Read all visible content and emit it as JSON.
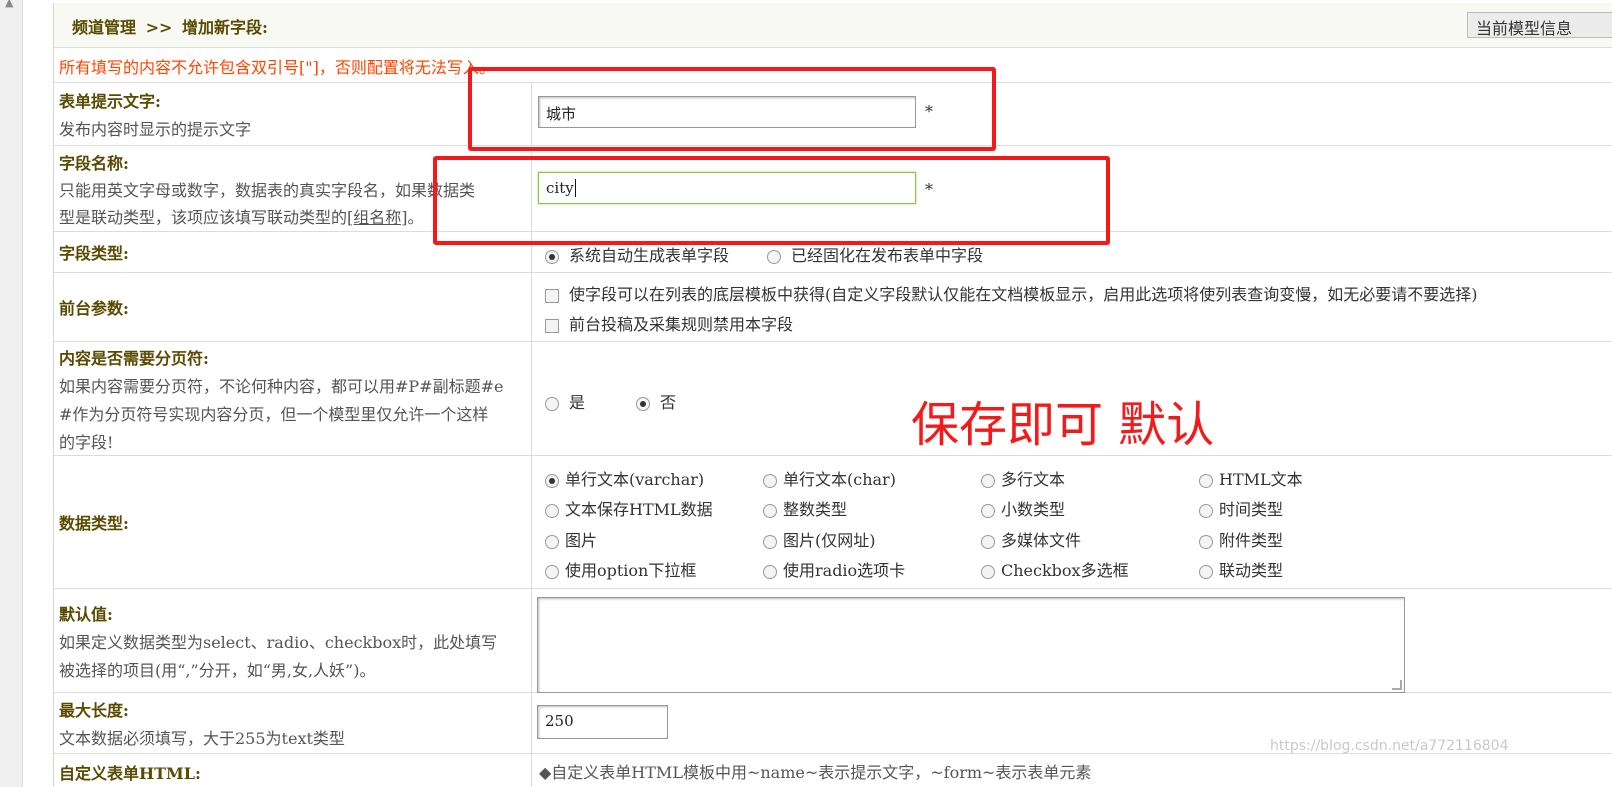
{
  "header": {
    "crumb_1": "频道管理",
    "crumb_sep": ">>",
    "crumb_2": "增加新字段:",
    "model_button": "当前模型信息"
  },
  "warning": "所有填写的内容不允许包含双引号[\"]，否则配置将无法写入。",
  "form_label": {
    "title": "表单提示文字:",
    "desc": "发布内容时显示的提示文字",
    "value": "城市",
    "required": "*"
  },
  "field_name": {
    "title": "字段名称:",
    "desc_1": "只能用英文字母或数字，数据表的真实字段名，如果数据类",
    "desc_2": "型是联动类型，该项应该填写联动类型的",
    "desc_link": "[组名称]",
    "desc_end": "。",
    "value": "city",
    "required": "*"
  },
  "field_type": {
    "title": "字段类型:",
    "options": [
      "系统自动生成表单字段",
      "已经固化在发布表单中字段"
    ],
    "selected": 0
  },
  "frontend": {
    "title": "前台参数:",
    "options": [
      "使字段可以在列表的底层模板中获得(自定义字段默认仅能在文档模板显示，启用此选项将使列表查询变慢，如无必要请不要选择)",
      "前台投稿及采集规则禁用本字段"
    ]
  },
  "pagebreak": {
    "title": "内容是否需要分页符:",
    "desc_1": "如果内容需要分页符，不论何种内容，都可以用#P#副标题#e",
    "desc_2": "#作为分页符号实现内容分页，但一个模型里仅允许一个这样",
    "desc_3": "的字段!",
    "options": [
      "是",
      "否"
    ],
    "selected": 1
  },
  "datatype": {
    "title": "数据类型:",
    "options": [
      "单行文本(varchar)",
      "单行文本(char)",
      "多行文本",
      "HTML文本",
      "文本保存HTML数据",
      "整数类型",
      "小数类型",
      "时间类型",
      "图片",
      "图片(仅网址)",
      "多媒体文件",
      "附件类型",
      "使用option下拉框",
      "使用radio选项卡",
      "Checkbox多选框",
      "联动类型"
    ],
    "selected": 0
  },
  "default_value": {
    "title": "默认值:",
    "desc_1": "如果定义数据类型为select、radio、checkbox时，此处填写",
    "desc_2": "被选择的项目(用“,”分开，如“男,女,人妖”)。"
  },
  "max_length": {
    "title": "最大长度:",
    "desc": "文本数据必须填写，大于255为text类型",
    "value": "250"
  },
  "custom_html": {
    "title": "自定义表单HTML:",
    "desc": "◆自定义表单HTML模板中用~name~表示提示文字，~form~表示表单元素"
  },
  "annotation": {
    "note": "保存即可 默认",
    "color": "#f21a1a"
  },
  "watermark": "https://blog.csdn.net/a772116804"
}
